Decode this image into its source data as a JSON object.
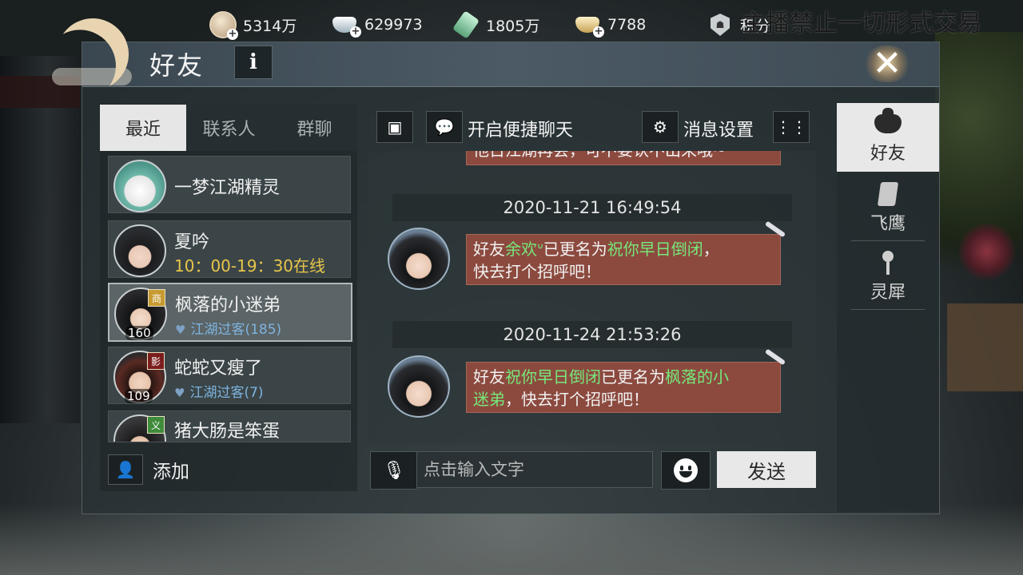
{
  "currency": [
    {
      "icon": "copper-coin-icon",
      "value": "5314万"
    },
    {
      "icon": "silver-ingot-icon",
      "value": "629973"
    },
    {
      "icon": "jade-icon",
      "value": "1805万"
    },
    {
      "icon": "gold-ingot-icon",
      "value": "7788"
    },
    {
      "icon": "points-badge-icon",
      "value": "积分"
    }
  ],
  "banner": "主播禁止一切形式交易",
  "window": {
    "title": "好友",
    "info_label": "i",
    "close_label": "✕"
  },
  "tabs": [
    {
      "label": "最近",
      "active": true
    },
    {
      "label": "联系人",
      "active": false
    },
    {
      "label": "群聊",
      "active": false
    }
  ],
  "contacts": [
    {
      "name": "一梦江湖精灵",
      "sub": "",
      "level": "",
      "tag": ""
    },
    {
      "name": "夏吟",
      "sub": "10：00-19：30在线",
      "level": "",
      "tag": ""
    },
    {
      "name": "枫落的小迷弟",
      "sub": "江湖过客(185)",
      "level": "160",
      "tag": "商",
      "selected": true
    },
    {
      "name": "蛇蛇又瘦了",
      "sub": "江湖过客(7)",
      "level": "109",
      "tag": "影"
    },
    {
      "name": "猪大肠是笨蛋",
      "sub": "",
      "level": "",
      "tag": "义"
    }
  ],
  "add_label": "添加",
  "toolbar": {
    "quick_chat_label": "开启便捷聊天",
    "msg_settings_label": "消息设置"
  },
  "chat": {
    "prev_message_partial": "他日江湖再会，可不要认不出来哦~",
    "messages": [
      {
        "timestamp": "2020-11-21 16:49:54",
        "line1_pre": "好友",
        "line1_hl1": "余欢ᐡ",
        "line1_mid": "已更名为",
        "line1_hl2": "祝你早日倒闭",
        "line1_post": "，",
        "line2": "快去打个招呼吧！"
      },
      {
        "timestamp": "2020-11-24 21:53:26",
        "line1_pre": "好友",
        "line1_hl1": "祝你早日倒闭",
        "line1_mid": "已更名为",
        "line1_hl2": "枫落的小",
        "line2_hl": "迷弟",
        "line2": "，快去打个招呼吧！"
      }
    ]
  },
  "input": {
    "placeholder": "点击输入文字",
    "send_label": "发送"
  },
  "side_tabs": [
    {
      "label": "好友",
      "icon": "teapot-icon",
      "active": true
    },
    {
      "label": "飞鹰",
      "icon": "scroll-icon",
      "active": false
    },
    {
      "label": "灵犀",
      "icon": "lingxi-icon",
      "active": false
    }
  ],
  "colors": {
    "highlight": "#77e87a",
    "bubble": "#8c4a3f",
    "online_text": "#e8c54a",
    "relation_text": "#7eb4e0"
  }
}
